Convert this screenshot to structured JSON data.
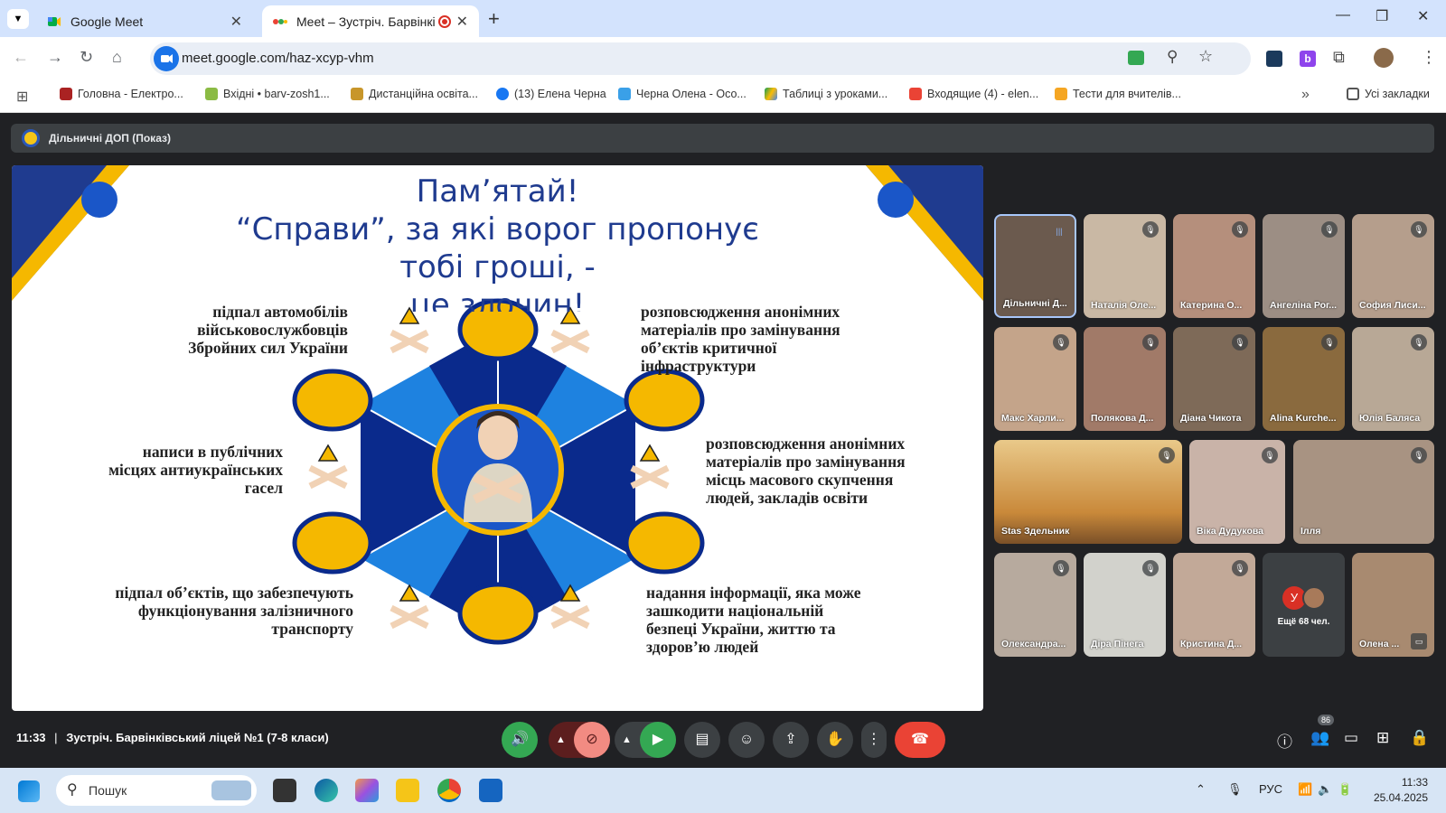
{
  "browser": {
    "tabs": [
      {
        "title": "Google Meet",
        "active": false
      },
      {
        "title": "Meet – Зустріч. Барвінківсь",
        "active": true
      }
    ],
    "url": "meet.google.com/haz-xcyp-vhm",
    "bookmarks": [
      "Головна - Електро...",
      "Вхідні • barv-zosh1...",
      "Дистанційна освіта...",
      "(13) Елена Черна",
      "Черна Олена - Осо...",
      "Таблиці з уроками...",
      "Входящие (4) - elen...",
      "Тести для вчителів..."
    ],
    "all_bookmarks": "Усі закладки"
  },
  "meet": {
    "presenter_bar": "Дільничні ДОП (Показ)",
    "slide": {
      "title_lines": [
        "Пам’ятай!",
        "“Справи”, за які ворог  пропонує",
        "тобі гроші, -",
        "це злочин!"
      ],
      "items": {
        "top_left": [
          "підпал автомобілів",
          "військовослужбовців",
          "Збройних сил України"
        ],
        "mid_left": [
          "написи в публічних",
          "місцях антиукраїнських",
          "гасел"
        ],
        "bot_left": [
          "підпал об’єктів, що забезпечують",
          "функціонування залізничного",
          "транспорту"
        ],
        "top_right": [
          "розповсюдження анонімних",
          "матеріалів про замінування",
          "об’єктів критичної",
          "інфраструктури"
        ],
        "mid_right": [
          "розповсюдження анонімних",
          "матеріалів про замінування",
          "місць масового скупчення",
          "людей, закладів освіти"
        ],
        "bot_right": [
          "надання інформації, яка може",
          "зашкодити національній",
          "безпеці України, життю та",
          "здоров’ю людей"
        ]
      }
    },
    "participants": [
      "Дільничні Д...",
      "Наталія Оле...",
      "Катерина О...",
      "Ангеліна Рог...",
      "София Лиси...",
      "Макс Харли...",
      "Полякова Д...",
      "Діана Чикота",
      "Alina Kurche...",
      "Юлія Баляса",
      "Stas Здельник",
      "Віка Дудукова",
      "Ілля",
      "Олександра...",
      "Діра Пінега",
      "Кристина Д...",
      "Олена ..."
    ],
    "more_count": "Ещё 68 чел.",
    "more_avatar": "У",
    "time": "11:33",
    "separator": "|",
    "meeting_name": "Зустріч. Барвінківський ліцей №1 (7-8 класи)",
    "participants_badge": "86"
  },
  "taskbar": {
    "search_placeholder": "Пошук",
    "lang": "РУС",
    "clock_time": "11:33",
    "clock_date": "25.04.2025"
  },
  "colors": {
    "end_call": "#ea4335",
    "mic_off": "#f28b82",
    "green": "#34a853",
    "slide_blue": "#1f3b8f",
    "accent_yellow": "#f5b800"
  }
}
